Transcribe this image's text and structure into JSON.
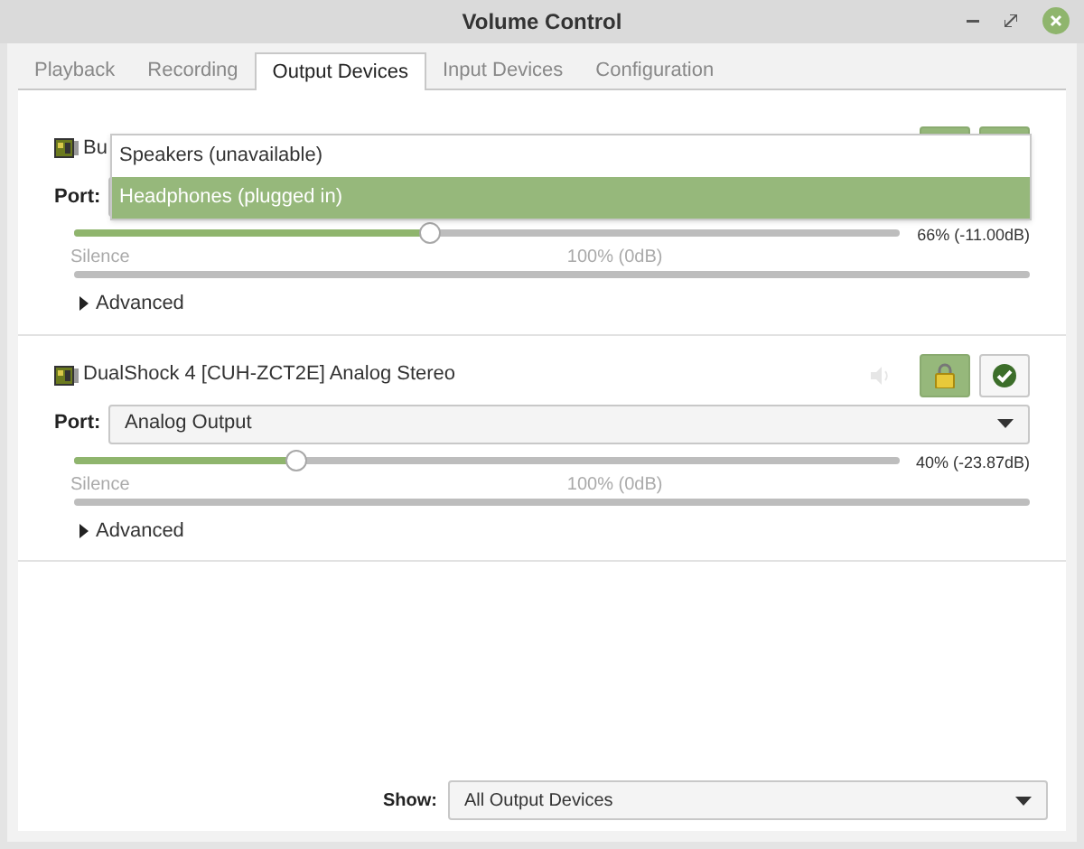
{
  "window": {
    "title": "Volume Control"
  },
  "tabs": [
    {
      "label": "Playback",
      "selected": false
    },
    {
      "label": "Recording",
      "selected": false
    },
    {
      "label": "Output Devices",
      "selected": true
    },
    {
      "label": "Input Devices",
      "selected": false
    },
    {
      "label": "Configuration",
      "selected": false
    }
  ],
  "devices": [
    {
      "name": "Bu",
      "port_label": "Port:",
      "locked": true,
      "default": true,
      "level": 0.43,
      "reading": "66% (-11.00dB)",
      "min_label": "Silence",
      "mark_label": "100% (0dB)",
      "advanced": "Advanced",
      "expanded": false,
      "port_menu": [
        {
          "label": "Speakers (unavailable)",
          "selected": false
        },
        {
          "label": "Headphones (plugged in)",
          "selected": true
        }
      ]
    },
    {
      "name": "DualShock 4 [CUH-ZCT2E] Analog Stereo",
      "port_label": "Port:",
      "port": "Analog Output",
      "locked": true,
      "default": false,
      "muted": false,
      "level": 0.27,
      "reading": "40% (-23.87dB)",
      "min_label": "Silence",
      "mark_label": "100% (0dB)",
      "advanced": "Advanced",
      "expanded": false
    }
  ],
  "show": {
    "label": "Show:",
    "value": "All Output Devices"
  }
}
